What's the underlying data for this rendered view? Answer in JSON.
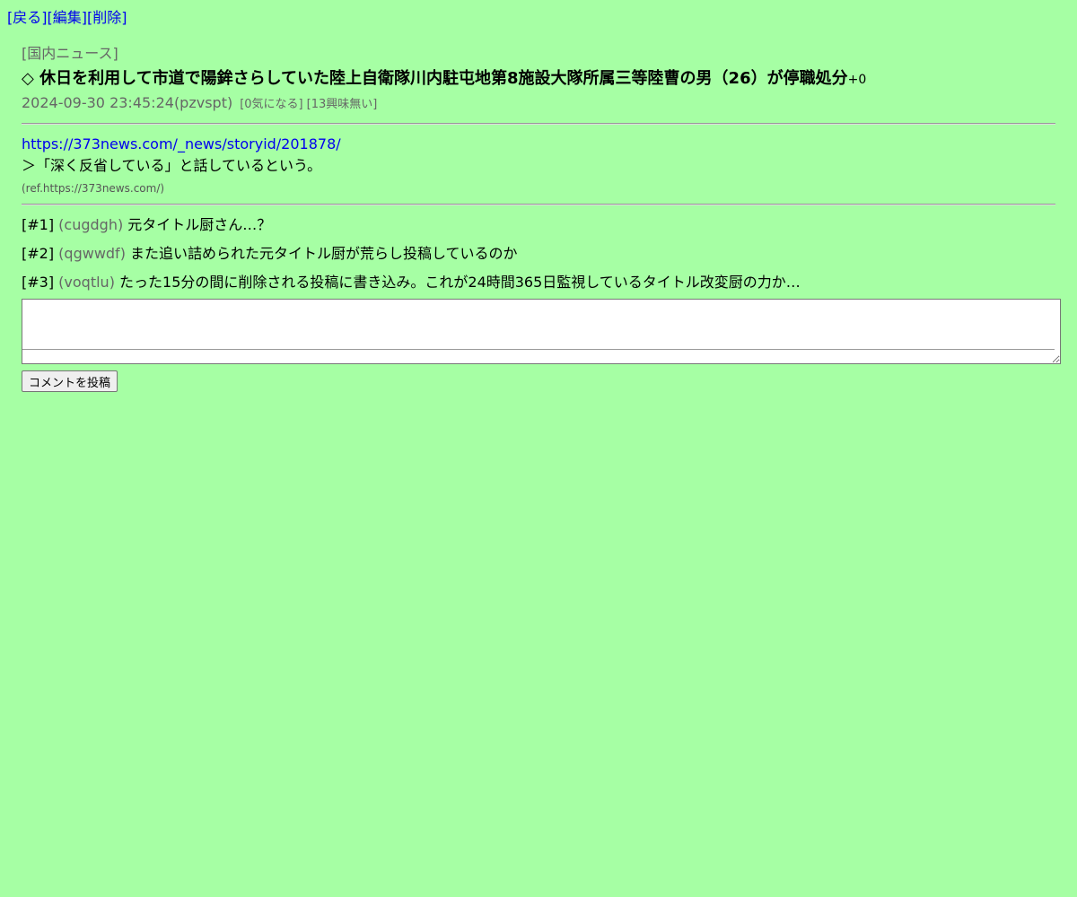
{
  "nav": {
    "back": "[戻る]",
    "edit": "[編集]",
    "delete": "[削除]"
  },
  "article": {
    "category": "[国内ニュース]",
    "title": "◇ 休日を利用して市道で陽鉾さらしていた陸上自衛隊川内駐屯地第8施設大隊所属三等陸曹の男（26）が停職処分",
    "score": "+0",
    "timestamp": "2024-09-30 23:45:24",
    "author_id": "(pzvspt)",
    "interest_action": "[0気になる]",
    "no_interest_action": "[13興味無い]",
    "url": "https://373news.com/_news/storyid/201878/",
    "quote": "＞「深く反省している」と話しているという。",
    "ref": "(ref.https://373news.com/)"
  },
  "comments": [
    {
      "num": "[#1]",
      "uid": "(cugdgh)",
      "text": "元タイトル厨さん…？"
    },
    {
      "num": "[#2]",
      "uid": "(qgwwdf)",
      "text": "また追い詰められた元タイトル厨が荒らし投稿しているのか"
    },
    {
      "num": "[#3]",
      "uid": "(voqtlu)",
      "text": "たった15分の間に削除される投稿に書き込み。これが24時間365日監視しているタイトル改変厨の力か…"
    }
  ],
  "form": {
    "textarea_value": "",
    "submit_label": "コメントを投稿"
  },
  "colors": {
    "background": "#a6ffa4",
    "link": "#0000ee",
    "muted": "#666666"
  }
}
